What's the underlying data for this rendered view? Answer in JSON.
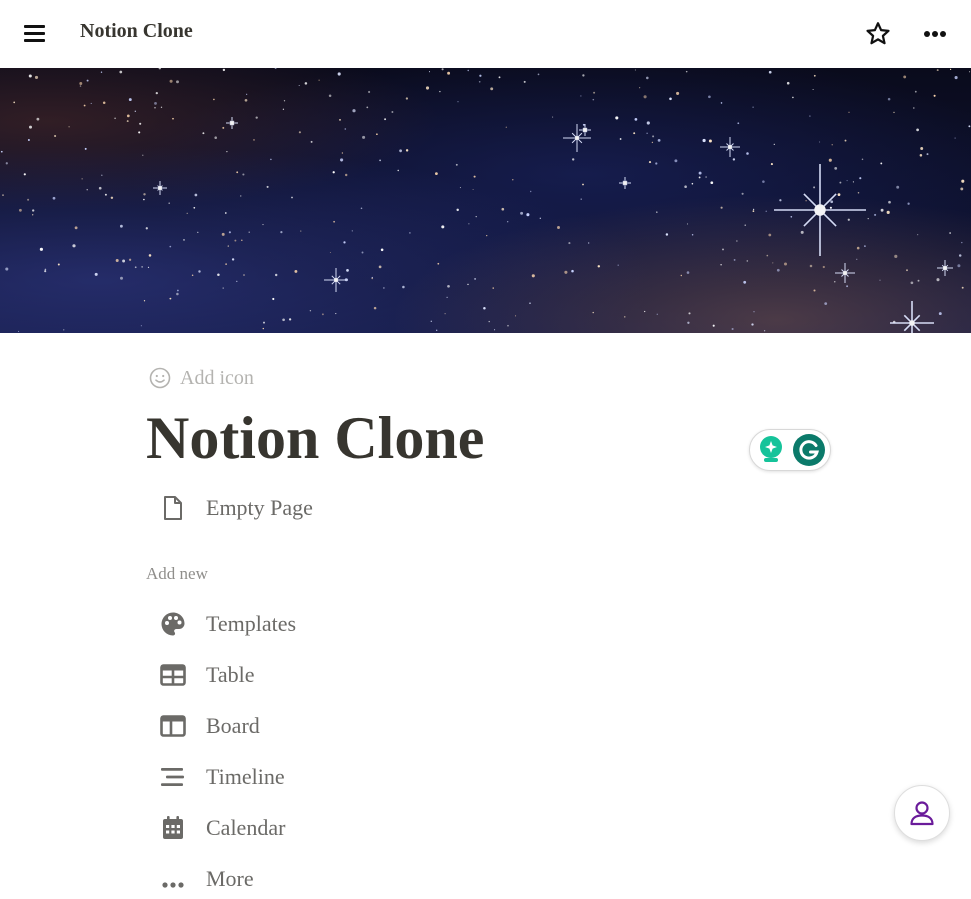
{
  "header": {
    "title": "Notion Clone",
    "menu_icon": "hamburger-icon",
    "favorite_icon": "star-outline-icon",
    "more_icon": "more-horizontal-icon"
  },
  "cover": {
    "image_alt": "starfield-cover-image"
  },
  "page": {
    "add_icon_label": "Add icon",
    "title": "Notion Clone",
    "subpages": [
      {
        "label": "Empty Page",
        "icon": "file-icon"
      }
    ]
  },
  "add_new": {
    "label": "Add new",
    "items": [
      {
        "label": "Templates",
        "icon": "palette-icon"
      },
      {
        "label": "Table",
        "icon": "table-icon"
      },
      {
        "label": "Board",
        "icon": "board-icon"
      },
      {
        "label": "Timeline",
        "icon": "timeline-icon"
      },
      {
        "label": "Calendar",
        "icon": "calendar-icon"
      },
      {
        "label": "More",
        "icon": "more-icon"
      }
    ]
  },
  "widgets": {
    "grammarly_icon": "grammarly-icon",
    "assistant_icon": "lightbulb-icon",
    "account_icon": "user-icon"
  },
  "colors": {
    "text": "#37352f",
    "muted": "#6b6a67",
    "placeholder": "#b4b3b0",
    "grammarly_green": "#15c39a",
    "grammarly_teal": "#0b7a6a",
    "account_purple": "#6a1b9a"
  }
}
